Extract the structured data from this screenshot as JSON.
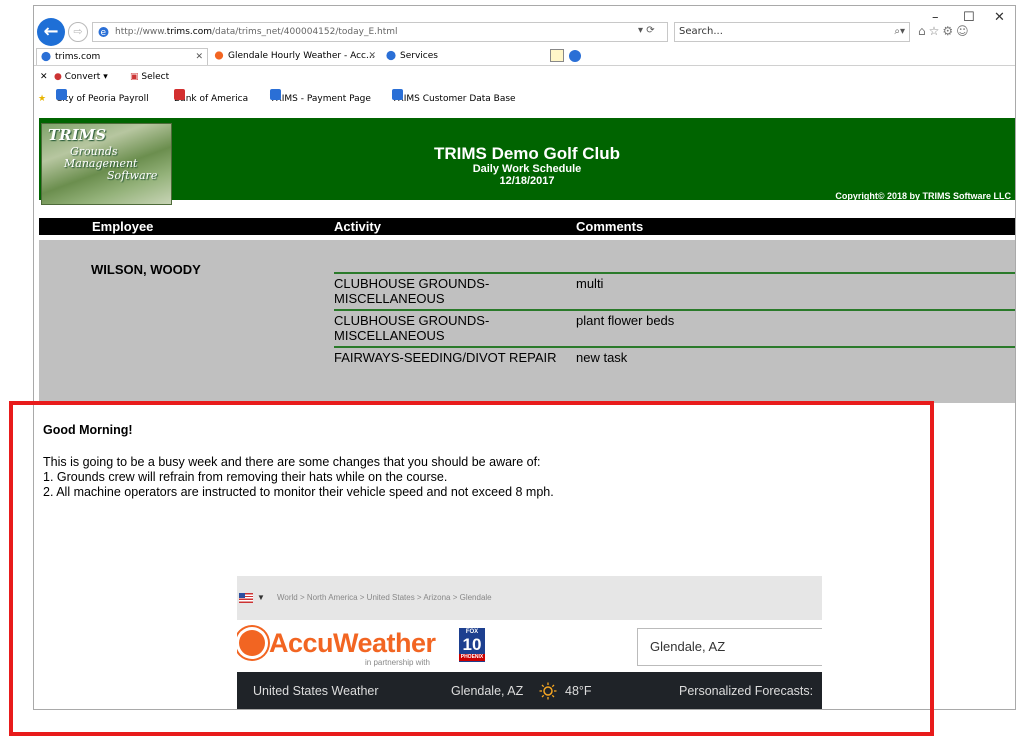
{
  "browser": {
    "url_prefix": "http://www.",
    "url_domain": "trims.com",
    "url_path": "/data/trims_net/400004152/today_E.html",
    "url_tools": "▾ ⟳",
    "search_placeholder": "Search...",
    "search_icon": "⌕▾",
    "min_glyph": "–",
    "max_glyph": "☐",
    "close_glyph": "✕",
    "toolbar_icons": "⌂☆⚙☺",
    "back_glyph": "←",
    "fwd_glyph": "⇨",
    "tabs": [
      {
        "label": "trims.com",
        "close": "✕"
      },
      {
        "label": "Glendale Hourly Weather - Acc...",
        "close": "✕"
      },
      {
        "label": "Services"
      }
    ],
    "command_bar": {
      "close_glyph": "✕",
      "convert_label": "Convert",
      "convert_caret": "▾",
      "select_label": "Select"
    },
    "favorites": [
      {
        "label": "City of Peoria Payroll",
        "color": "#2a6fd6"
      },
      {
        "label": "Bank of America",
        "color": "#d32f2f"
      },
      {
        "label": "TRIMS - Payment Page",
        "color": "#2a6fd6"
      },
      {
        "label": "TRIMS Customer Data Base",
        "color": "#2a6fd6"
      }
    ]
  },
  "trims": {
    "logo": {
      "line1": "TRIMS",
      "line2": "Grounds",
      "line3": "Management",
      "line4": "Software"
    },
    "title": "TRIMS Demo Golf Club",
    "subtitle": "Daily Work Schedule",
    "date": "12/18/2017",
    "copyright": "Copyright© 2018 by TRIMS Software LLC",
    "columns": {
      "employee": "Employee",
      "activity": "Activity",
      "comments": "Comments"
    },
    "employee": "WILSON, WOODY",
    "rows": [
      {
        "activity": "CLUBHOUSE GROUNDS-MISCELLANEOUS",
        "comment": "multi"
      },
      {
        "activity": "CLUBHOUSE GROUNDS-MISCELLANEOUS",
        "comment": "plant flower beds"
      },
      {
        "activity": "FAIRWAYS-SEEDING/DIVOT REPAIR",
        "comment": "new task"
      }
    ],
    "message": {
      "greeting": "Good Morning!",
      "lines": [
        "This is going to be a busy week and there are some changes that you should be aware of:",
        "1. Grounds crew will refrain from removing their hats while on the course.",
        "2. All machine operators are instructed to monitor their vehicle speed and not exceed 8 mph."
      ]
    }
  },
  "accuweather": {
    "flag_caret": "▼",
    "breadcrumb": "World > North America > United States > Arizona > Glendale",
    "brand": "AccuWeather",
    "partnership": "in partnership with",
    "fox_top": "FOX",
    "fox_num": "10",
    "fox_bottom": "PHOENIX",
    "search_value": "Glendale, AZ",
    "nav": {
      "us_weather": "United States Weather",
      "current_location": "Glendale, AZ",
      "temperature": "48°F",
      "personalized": "Personalized Forecasts:"
    },
    "accent_color": "#f26522"
  },
  "highlight_color": "#e81b1b"
}
